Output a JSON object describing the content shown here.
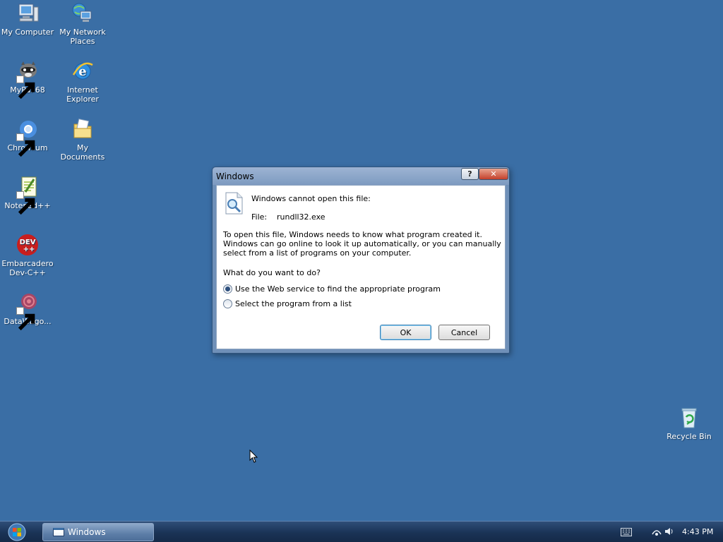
{
  "desktop": {
    "icons": [
      {
        "label_line1": "My Computer",
        "label_line2": ""
      },
      {
        "label_line1": "My Network",
        "label_line2": "Places"
      },
      {
        "label_line1": "MyPal 68",
        "label_line2": ""
      },
      {
        "label_line1": "Internet",
        "label_line2": "Explorer"
      },
      {
        "label_line1": "Chromium",
        "label_line2": ""
      },
      {
        "label_line1": "My",
        "label_line2": "Documents"
      },
      {
        "label_line1": "Notepad++",
        "label_line2": ""
      },
      {
        "label_line1": "Embarcadero",
        "label_line2": "Dev-C++"
      },
      {
        "label_line1": "DataWago...",
        "label_line2": ""
      }
    ],
    "recycle_bin": "Recycle Bin"
  },
  "dialog": {
    "title": "Windows",
    "help_glyph": "?",
    "close_glyph": "✕",
    "message": "Windows cannot open this file:",
    "file_label": "File:",
    "file_name": "rundll32.exe",
    "explanation": "To open this file, Windows needs to know what program created it.  Windows can go online to look it up automatically, or you can manually select from a list of programs on your computer.",
    "question": "What do you want to do?",
    "options": [
      {
        "label": "Use the Web service to find the appropriate program",
        "checked": true
      },
      {
        "label": "Select the program from a list",
        "checked": false
      }
    ],
    "ok_label": "OK",
    "cancel_label": "Cancel"
  },
  "taskbar": {
    "task_label": "Windows",
    "clock": "4:43 PM"
  },
  "colors": {
    "desktop": "#3a6ea5",
    "taskbar": "#1a3356"
  }
}
